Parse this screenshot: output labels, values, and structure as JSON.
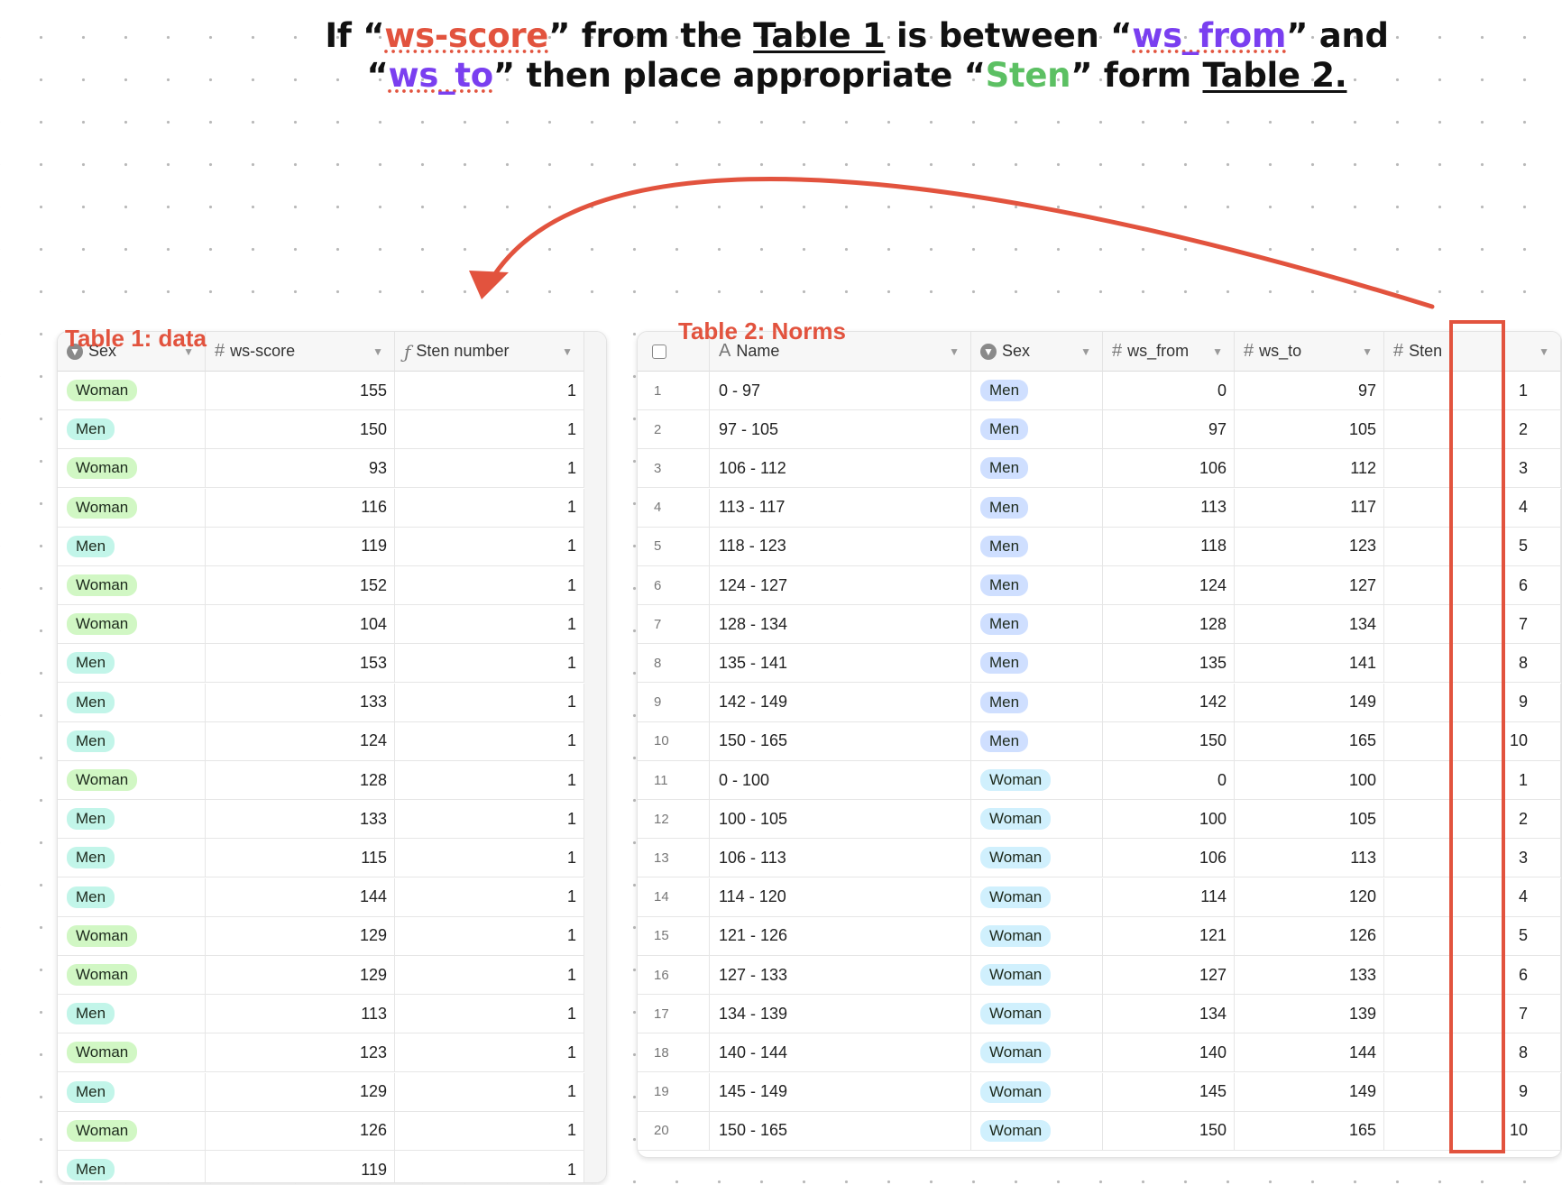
{
  "headline": {
    "l1_a": "If “",
    "l1_ws_score": "ws-score",
    "l1_b": "” from the ",
    "l1_table1": "Table 1",
    "l1_c": " is between “",
    "l1_ws_from": "ws_from",
    "l1_d": "” and",
    "l2_a": "“",
    "l2_ws_to": "ws_to",
    "l2_b": "” then place appropriate “",
    "l2_sten": "Sten",
    "l2_c": "” form ",
    "l2_table2": "Table 2."
  },
  "colors": {
    "annotation_red": "#e2533e",
    "purple": "#7a3ff0",
    "green": "#5cc063",
    "pill_woman_t1": "#d1f7c4",
    "pill_men_t1": "#c2f5e9",
    "pill_men_t2": "#cfdfff",
    "pill_woman_t2": "#d0f0fd"
  },
  "table1": {
    "label": "Table 1: data",
    "columns": [
      {
        "key": "sex",
        "label": "Sex",
        "icon": "single-select-icon"
      },
      {
        "key": "ws_score",
        "label": "ws-score",
        "icon": "number-icon"
      },
      {
        "key": "sten_number",
        "label": "Sten number",
        "icon": "formula-icon"
      }
    ],
    "rows": [
      {
        "sex": "Woman",
        "ws_score": "155",
        "sten_number": "1"
      },
      {
        "sex": "Men",
        "ws_score": "150",
        "sten_number": "1"
      },
      {
        "sex": "Woman",
        "ws_score": "93",
        "sten_number": "1"
      },
      {
        "sex": "Woman",
        "ws_score": "116",
        "sten_number": "1"
      },
      {
        "sex": "Men",
        "ws_score": "119",
        "sten_number": "1"
      },
      {
        "sex": "Woman",
        "ws_score": "152",
        "sten_number": "1"
      },
      {
        "sex": "Woman",
        "ws_score": "104",
        "sten_number": "1"
      },
      {
        "sex": "Men",
        "ws_score": "153",
        "sten_number": "1"
      },
      {
        "sex": "Men",
        "ws_score": "133",
        "sten_number": "1"
      },
      {
        "sex": "Men",
        "ws_score": "124",
        "sten_number": "1"
      },
      {
        "sex": "Woman",
        "ws_score": "128",
        "sten_number": "1"
      },
      {
        "sex": "Men",
        "ws_score": "133",
        "sten_number": "1"
      },
      {
        "sex": "Men",
        "ws_score": "115",
        "sten_number": "1"
      },
      {
        "sex": "Men",
        "ws_score": "144",
        "sten_number": "1"
      },
      {
        "sex": "Woman",
        "ws_score": "129",
        "sten_number": "1"
      },
      {
        "sex": "Woman",
        "ws_score": "129",
        "sten_number": "1"
      },
      {
        "sex": "Men",
        "ws_score": "113",
        "sten_number": "1"
      },
      {
        "sex": "Woman",
        "ws_score": "123",
        "sten_number": "1"
      },
      {
        "sex": "Men",
        "ws_score": "129",
        "sten_number": "1"
      },
      {
        "sex": "Woman",
        "ws_score": "126",
        "sten_number": "1"
      },
      {
        "sex": "Men",
        "ws_score": "119",
        "sten_number": "1"
      }
    ]
  },
  "table2": {
    "label": "Table 2: Norms",
    "columns": [
      {
        "key": "name",
        "label": "Name",
        "icon": "text-icon"
      },
      {
        "key": "sex",
        "label": "Sex",
        "icon": "single-select-icon"
      },
      {
        "key": "ws_from",
        "label": "ws_from",
        "icon": "number-icon"
      },
      {
        "key": "ws_to",
        "label": "ws_to",
        "icon": "number-icon"
      },
      {
        "key": "sten",
        "label": "Sten",
        "icon": "number-icon"
      }
    ],
    "rows": [
      {
        "idx": "1",
        "name": "0 - 97",
        "sex": "Men",
        "ws_from": "0",
        "ws_to": "97",
        "sten": "1"
      },
      {
        "idx": "2",
        "name": "97 - 105",
        "sex": "Men",
        "ws_from": "97",
        "ws_to": "105",
        "sten": "2"
      },
      {
        "idx": "3",
        "name": "106 - 112",
        "sex": "Men",
        "ws_from": "106",
        "ws_to": "112",
        "sten": "3"
      },
      {
        "idx": "4",
        "name": "113 - 117",
        "sex": "Men",
        "ws_from": "113",
        "ws_to": "117",
        "sten": "4"
      },
      {
        "idx": "5",
        "name": "118 - 123",
        "sex": "Men",
        "ws_from": "118",
        "ws_to": "123",
        "sten": "5"
      },
      {
        "idx": "6",
        "name": "124 - 127",
        "sex": "Men",
        "ws_from": "124",
        "ws_to": "127",
        "sten": "6"
      },
      {
        "idx": "7",
        "name": "128 - 134",
        "sex": "Men",
        "ws_from": "128",
        "ws_to": "134",
        "sten": "7"
      },
      {
        "idx": "8",
        "name": "135 - 141",
        "sex": "Men",
        "ws_from": "135",
        "ws_to": "141",
        "sten": "8"
      },
      {
        "idx": "9",
        "name": "142 - 149",
        "sex": "Men",
        "ws_from": "142",
        "ws_to": "149",
        "sten": "9"
      },
      {
        "idx": "10",
        "name": "150 - 165",
        "sex": "Men",
        "ws_from": "150",
        "ws_to": "165",
        "sten": "10"
      },
      {
        "idx": "11",
        "name": "0 - 100",
        "sex": "Woman",
        "ws_from": "0",
        "ws_to": "100",
        "sten": "1"
      },
      {
        "idx": "12",
        "name": "100 - 105",
        "sex": "Woman",
        "ws_from": "100",
        "ws_to": "105",
        "sten": "2"
      },
      {
        "idx": "13",
        "name": "106 - 113",
        "sex": "Woman",
        "ws_from": "106",
        "ws_to": "113",
        "sten": "3"
      },
      {
        "idx": "14",
        "name": "114 - 120",
        "sex": "Woman",
        "ws_from": "114",
        "ws_to": "120",
        "sten": "4"
      },
      {
        "idx": "15",
        "name": "121 - 126",
        "sex": "Woman",
        "ws_from": "121",
        "ws_to": "126",
        "sten": "5"
      },
      {
        "idx": "16",
        "name": "127 - 133",
        "sex": "Woman",
        "ws_from": "127",
        "ws_to": "133",
        "sten": "6"
      },
      {
        "idx": "17",
        "name": "134 - 139",
        "sex": "Woman",
        "ws_from": "134",
        "ws_to": "139",
        "sten": "7"
      },
      {
        "idx": "18",
        "name": "140 - 144",
        "sex": "Woman",
        "ws_from": "140",
        "ws_to": "144",
        "sten": "8"
      },
      {
        "idx": "19",
        "name": "145 - 149",
        "sex": "Woman",
        "ws_from": "145",
        "ws_to": "149",
        "sten": "9"
      },
      {
        "idx": "20",
        "name": "150 - 165",
        "sex": "Woman",
        "ws_from": "150",
        "ws_to": "165",
        "sten": "10"
      }
    ]
  }
}
